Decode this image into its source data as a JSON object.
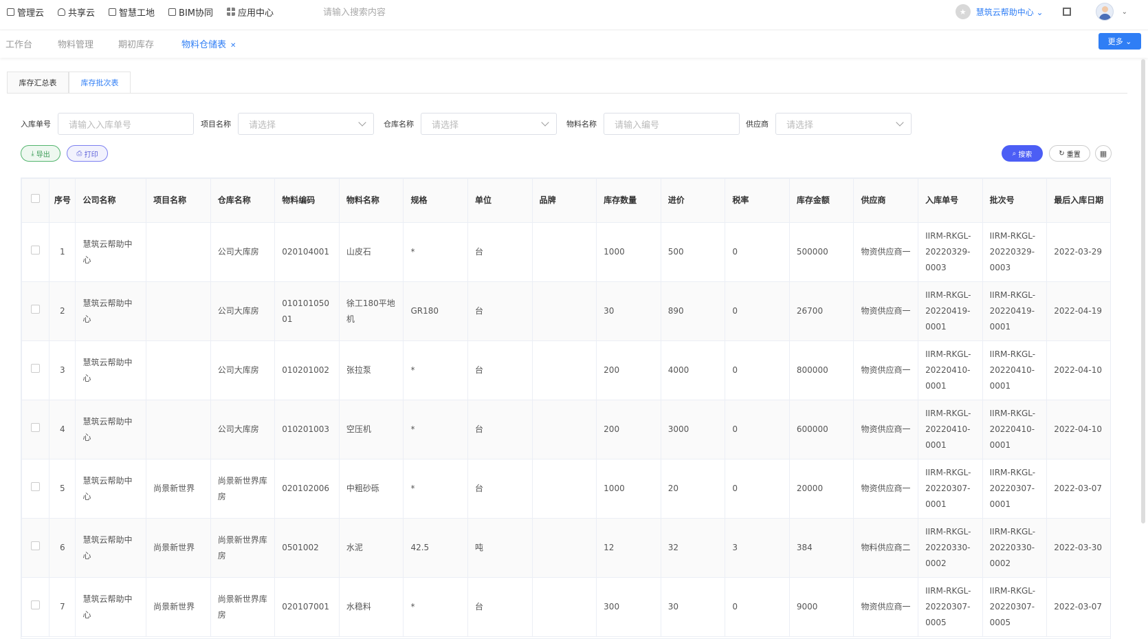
{
  "topnav": {
    "items": [
      {
        "label": "管理云",
        "icon": "doc-icon"
      },
      {
        "label": "共享云",
        "icon": "cloud-icon"
      },
      {
        "label": "智慧工地",
        "icon": "doc-icon"
      },
      {
        "label": "BIM协同",
        "icon": "cube-icon"
      },
      {
        "label": "应用中心",
        "icon": "grid-icon"
      }
    ],
    "search_placeholder": "请输入搜索内容",
    "org_name": "慧筑云帮助中心"
  },
  "route_tabs": [
    {
      "label": "工作台"
    },
    {
      "label": "物料管理"
    },
    {
      "label": "期初库存"
    },
    {
      "label": "物料仓储表"
    }
  ],
  "more_label": "更多",
  "subtabs": [
    "库存汇总表",
    "库存批次表"
  ],
  "filters": [
    {
      "label": "入库单号",
      "placeholder": "请输入入库单号"
    },
    {
      "label": "项目名称",
      "placeholder": "请选择"
    },
    {
      "label": "仓库名称",
      "placeholder": "请选择"
    },
    {
      "label": "物料名称",
      "placeholder": "请输入编号"
    },
    {
      "label": "供应商",
      "placeholder": "请选择"
    }
  ],
  "actions": {
    "export": "导出",
    "print": "打印",
    "search": "搜索",
    "reset": "重置"
  },
  "table": {
    "headers": [
      "序号",
      "公司名称",
      "项目名称",
      "仓库名称",
      "物料编码",
      "物料名称",
      "规格",
      "单位",
      "品牌",
      "库存数量",
      "进价",
      "税率",
      "库存金额",
      "供应商",
      "入库单号",
      "批次号",
      "最后入库日期"
    ],
    "rows": [
      [
        "1",
        "慧筑云帮助中心",
        "",
        "公司大库房",
        "020104001",
        "山皮石",
        "*",
        "台",
        "",
        "1000",
        "500",
        "0",
        "500000",
        "物资供应商一",
        "IIRM-RKGL-20220329-0003",
        "IIRM-RKGL-20220329-0003",
        "2022-03-29"
      ],
      [
        "2",
        "慧筑云帮助中心",
        "",
        "公司大库房",
        "01010105001",
        "徐工180平地机",
        "GR180",
        "台",
        "",
        "30",
        "890",
        "0",
        "26700",
        "物资供应商一",
        "IIRM-RKGL-20220419-0001",
        "IIRM-RKGL-20220419-0001",
        "2022-04-19"
      ],
      [
        "3",
        "慧筑云帮助中心",
        "",
        "公司大库房",
        "010201002",
        "张拉泵",
        "*",
        "台",
        "",
        "200",
        "4000",
        "0",
        "800000",
        "物资供应商一",
        "IIRM-RKGL-20220410-0001",
        "IIRM-RKGL-20220410-0001",
        "2022-04-10"
      ],
      [
        "4",
        "慧筑云帮助中心",
        "",
        "公司大库房",
        "010201003",
        "空压机",
        "*",
        "台",
        "",
        "200",
        "3000",
        "0",
        "600000",
        "物资供应商一",
        "IIRM-RKGL-20220410-0001",
        "IIRM-RKGL-20220410-0001",
        "2022-04-10"
      ],
      [
        "5",
        "慧筑云帮助中心",
        "尚景新世界",
        "尚景新世界库房",
        "020102006",
        "中粗砂砾",
        "*",
        "台",
        "",
        "1000",
        "20",
        "0",
        "20000",
        "物资供应商一",
        "IIRM-RKGL-20220307-0001",
        "IIRM-RKGL-20220307-0001",
        "2022-03-07"
      ],
      [
        "6",
        "慧筑云帮助中心",
        "尚景新世界",
        "尚景新世界库房",
        "0501002",
        "水泥",
        "42.5",
        "吨",
        "",
        "12",
        "32",
        "3",
        "384",
        "物料供应商二",
        "IIRM-RKGL-20220330-0002",
        "IIRM-RKGL-20220330-0002",
        "2022-03-30"
      ],
      [
        "7",
        "慧筑云帮助中心",
        "尚景新世界",
        "尚景新世界库房",
        "020107001",
        "水稳料",
        "*",
        "台",
        "",
        "300",
        "30",
        "0",
        "9000",
        "物资供应商一",
        "IIRM-RKGL-20220307-0005",
        "IIRM-RKGL-20220307-0005",
        "2022-03-07"
      ]
    ]
  }
}
